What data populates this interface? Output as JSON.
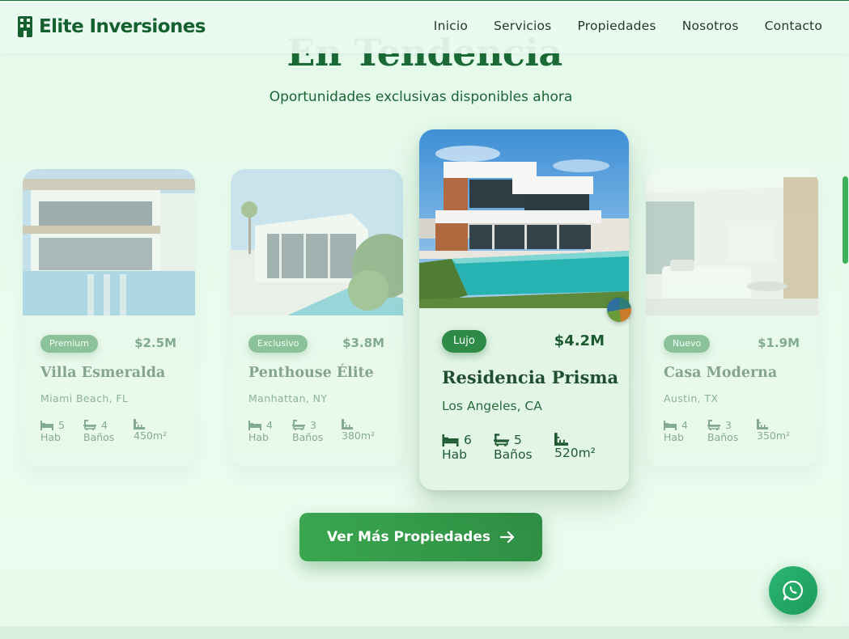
{
  "nav": {
    "brand": "Elite Inversiones",
    "links": [
      "Inicio",
      "Servicios",
      "Propiedades",
      "Nosotros",
      "Contacto"
    ]
  },
  "section": {
    "title": "En Tendencia",
    "subtitle": "Oportunidades exclusivas disponibles ahora"
  },
  "properties": [
    {
      "badge": "Premium",
      "price": "$2.5M",
      "name": "Villa Esmeralda",
      "location": "Miami Beach, FL",
      "beds": "5",
      "beds_label": "Hab",
      "baths": "4",
      "baths_label": "Baños",
      "area": "450m²"
    },
    {
      "badge": "Exclusivo",
      "price": "$3.8M",
      "name": "Penthouse Élite",
      "location": "Manhattan, NY",
      "beds": "4",
      "beds_label": "Hab",
      "baths": "3",
      "baths_label": "Baños",
      "area": "380m²"
    },
    {
      "badge": "Lujo",
      "price": "$4.2M",
      "name": "Residencia Prisma",
      "location": "Los Angeles, CA",
      "beds": "6",
      "beds_label": "Hab",
      "baths": "5",
      "baths_label": "Baños",
      "area": "520m²"
    },
    {
      "badge": "Nuevo",
      "price": "$1.9M",
      "name": "Casa Moderna",
      "location": "Austin, TX",
      "beds": "4",
      "beds_label": "Hab",
      "baths": "3",
      "baths_label": "Baños",
      "area": "350m²"
    }
  ],
  "cta": {
    "label": "Ver Más Propiedades",
    "icon": "arrow-right-icon"
  },
  "floating": {
    "icon": "whatsapp-icon"
  },
  "colors": {
    "brand": "#15602f",
    "accent": "#2d8a47",
    "cta": "#3aa650",
    "whatsapp": "#2bb673",
    "background": "#e9fbee"
  }
}
